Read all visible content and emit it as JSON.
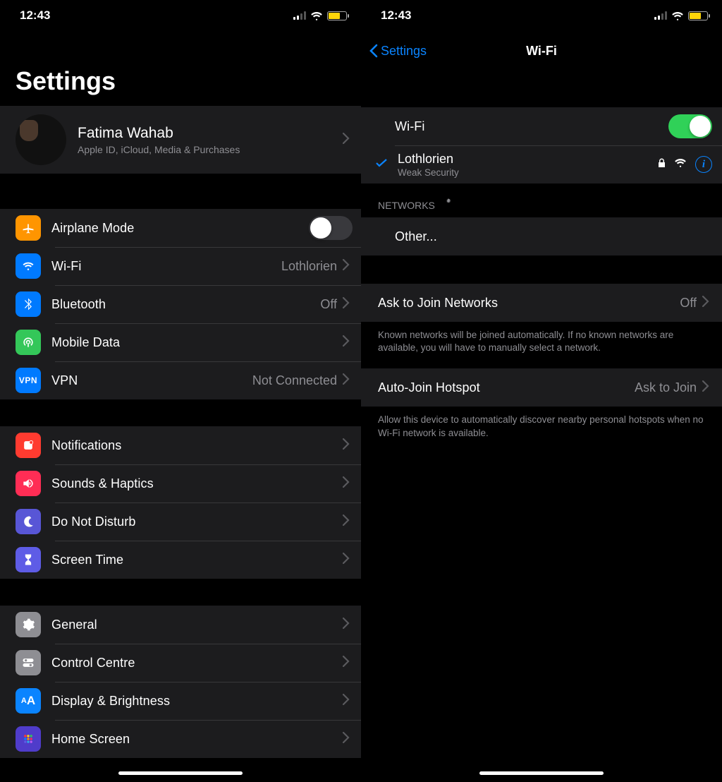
{
  "status": {
    "time": "12:43"
  },
  "left": {
    "title": "Settings",
    "profile": {
      "name": "Fatima Wahab",
      "sub": "Apple ID, iCloud, Media & Purchases"
    },
    "group1": {
      "airplane": "Airplane Mode",
      "wifi": {
        "label": "Wi-Fi",
        "value": "Lothlorien"
      },
      "bluetooth": {
        "label": "Bluetooth",
        "value": "Off"
      },
      "mobile": "Mobile Data",
      "vpn": {
        "label": "VPN",
        "value": "Not Connected"
      }
    },
    "group2": {
      "notifications": "Notifications",
      "sounds": "Sounds & Haptics",
      "dnd": "Do Not Disturb",
      "screentime": "Screen Time"
    },
    "group3": {
      "general": "General",
      "control": "Control Centre",
      "display": "Display & Brightness",
      "home": "Home Screen"
    }
  },
  "right": {
    "back": "Settings",
    "title": "Wi-Fi",
    "toggle_label": "Wi-Fi",
    "connected": {
      "name": "Lothlorien",
      "sub": "Weak Security"
    },
    "networks_header": "NETWORKS",
    "other": "Other...",
    "ask_join": {
      "label": "Ask to Join Networks",
      "value": "Off"
    },
    "ask_join_footer": "Known networks will be joined automatically. If no known networks are available, you will have to manually select a network.",
    "auto_hotspot": {
      "label": "Auto-Join Hotspot",
      "value": "Ask to Join"
    },
    "auto_hotspot_footer": "Allow this device to automatically discover nearby personal hotspots when no Wi-Fi network is available."
  }
}
